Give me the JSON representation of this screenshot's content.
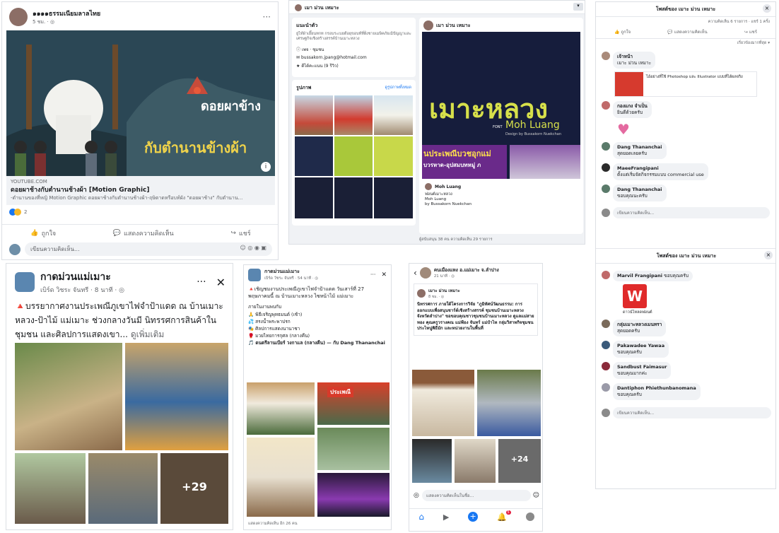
{
  "post1": {
    "page_name": "๑๑๑๑ธรรมเนียมลาลไทย",
    "time": "5 ชม. · ◎",
    "banner_title_1": "ดอยผาข้าง",
    "banner_title_2": "กับตำนานข้างผ้า",
    "link_domain": "YOUTUBE.COM",
    "link_title": "ดอยผาช้างกับตำนานช้างผ้า [Motion Graphic]",
    "link_desc": "-ตำนานของที่หญิ Motion Graphic ดอยผาช้างกับตำนานช้างผ้า-ฤษิตาดหรือบท์ผัง \"ดอยผาช้าง\" กับตำนาน...",
    "reaction_count": "2",
    "like_label": "ถูกใจ",
    "comment_label": "แสดงความคิดเห็น",
    "share_label": "แชร์",
    "comment_placeholder": "เขียนความคิดเห็น..."
  },
  "post2": {
    "top_name": "เมา ม่วน เหมาะ",
    "about_heading": "แนะนำตัว",
    "about_text": "ยู่ไท์ผ้าเอี๊ยนทกท กรอบระเบยดีอยุขอบท์ที่ฝั่งชายเมษิคภัยเมิปัญญาและเศรษฐกิจเชิงสร้างสรรค์บ้านเมาะหลวง",
    "info1": "เพจ · ชุมชน",
    "info2": "bussakorn.jpang@hotmail.com",
    "info3": "ดีได้คะแนน (9 รีวิว)",
    "photos_heading": "รูปภาพ",
    "photos_link": "ดูรูปภาพทั้งหมด",
    "poster_title": "เมาะหลวง",
    "poster_font": "FONT",
    "poster_subtitle": "Moh Luang",
    "poster_designer": "Design by Bussakorn Nuekchan",
    "poster_banner": "นประเพณีบวชอุกแม่",
    "poster_banner2": "บวรหาด-อุปสมบทหมู่ ภ",
    "post_caption_name": "Moh Luang",
    "post_caption_lines": [
      "ฟอนต์เมาะหลวง",
      "Moh Luang",
      "by Bussakorn Nuekchan"
    ],
    "footer": "ผู้สนับสนุน 38 คน ความคิดเห็น 29 รายการ"
  },
  "post3": {
    "header_title": "โพสต์ของ เมาะ ม่วน เหมาะ",
    "stats": "ความคิดเห็น 6 รายการ · แชร์ 1 ครั้ง",
    "like_label": "ถูกใจ",
    "comment_label": "แสดงความคิดเห็น",
    "share_label": "แชร์",
    "sort_label": "เกี่ยวข้องมากที่สุด",
    "link_preview_title": "ไอ้อย่างที่ใช้ Photoshop และ Illustrator แบบที่ได้ผลจริง",
    "comments": [
      {
        "name": "เจ้าหน้า",
        "text": "เมาะ ม่วน เหมาะ"
      },
      {
        "name": "กองแกง จำเป็น",
        "text": "ยินดีด้วยครับ"
      },
      {
        "name": "Dang Thananchai",
        "text": "สุดยอดเลยครับ"
      },
      {
        "name": "MaeeFrangipani",
        "text": "ตั้งแต่เริ่มจัดกิจกรรมแบบ commercial use"
      },
      {
        "name": "Dang Thananchai",
        "text": "ขอบคุณนะครับ"
      }
    ],
    "write_placeholder": "เขียนความคิดเห็น...",
    "header_title_2": "โพสต์ของ เมาะ ม่วน เหมาะ",
    "link2_text": "ดาวน์โหลดฟอนต์",
    "comments2": [
      {
        "name": "Marvil Frangipani",
        "text": "ขอบคุณครับ"
      },
      {
        "name": "กลุ่มเมาะหลวงเมนทรา",
        "text": "สุดยอดครับ"
      },
      {
        "name": "Pakawadee Yawaa",
        "text": "ขอบคุณครับ"
      },
      {
        "name": "Sandbust Faimasur",
        "text": "ขอบคุณมากค่ะ"
      },
      {
        "name": "Dantiphon Phiethunbanomana",
        "text": "ขอบคุณครับ"
      }
    ],
    "write_placeholder_2": "เขียนความคิดเห็น..."
  },
  "post4": {
    "group_name": "กาดม่วนแม่เมาะ",
    "author": "เบิร์ด วิชระ จันทรี · 8 นาที · ◎",
    "text": "บรรยากาศงานประเพณีภูเขาไฟจำป้าแดด ณ บ้านเมาะหลวง-ป้าไม้ แม่เมาะ ช่วงกลางวันมี นิทรรศการสินค้าในชุมชน และศิลปการแสดงเขา...",
    "see_more": "ดูเพิ่มเติม",
    "more_photos": "+29"
  },
  "post5": {
    "group_name": "กาดม่วนแม่เมาะ",
    "author": "เบิร์ด วัชระ จันทรี · 54 นาที · ◎",
    "line1": "เชิญชมงานประเพณีภูเขาไฟจำป้าแดด วันเสาร์ที่ 27 พฤษภาคมนี้ ณ บ้านเมาะหลวง ไซหน้าไม้ แม่เมาะ",
    "program_heading": "ภายในงานพบกับ",
    "items": [
      "พิธีเจริญพุทธมนต์ (เช้า)",
      "สรงน้ำพระพาปรก",
      "ศิลปการแสดงนานาชา",
      "มวยไทยการกุศล (กลางคืน)",
      "ดนตรีลานเบียร์ วงกาแล (กลางคืน) — กับ Dang Thananchai"
    ],
    "sign_text": "ประเพณี",
    "footer": "แสดงความคิดเห็น อีก 26 คน"
  },
  "post6": {
    "group_name": "คนเมืองแหง อ.แม่เมาะ จ.ลำปาง",
    "time": "21 นาที · ◎",
    "author": "เมาะ ม่วน เหมาะ",
    "author_time": "8 ชม. · ◎",
    "text": "นิทรรศการ ภายใต้โครงการวิจัย \"ภูมิทัศน์วัฒนธรรม: การออกแบบเพื่อสนุนชาร์ต์เชิงสร้างสรรค์ ชุมชนบ้านเมาะหลวง จังหวัดลำปาง\" ขอขอบคุณชาวชุมชนบ้านเมาะหลวง ดูแลแม่สายทอง คุณครูวรางคณ แม่ฟ้อง จันทร์ แม่ปำไห กลุ่มวิสาหกิจชุมชนประไหนู่พิธีมัก และหน่วยงานในพื้นที่",
    "more_photos": "+24",
    "comment_placeholder": "แสดงความคิดเห็นในชื่อ...",
    "nav_badge": "5"
  }
}
